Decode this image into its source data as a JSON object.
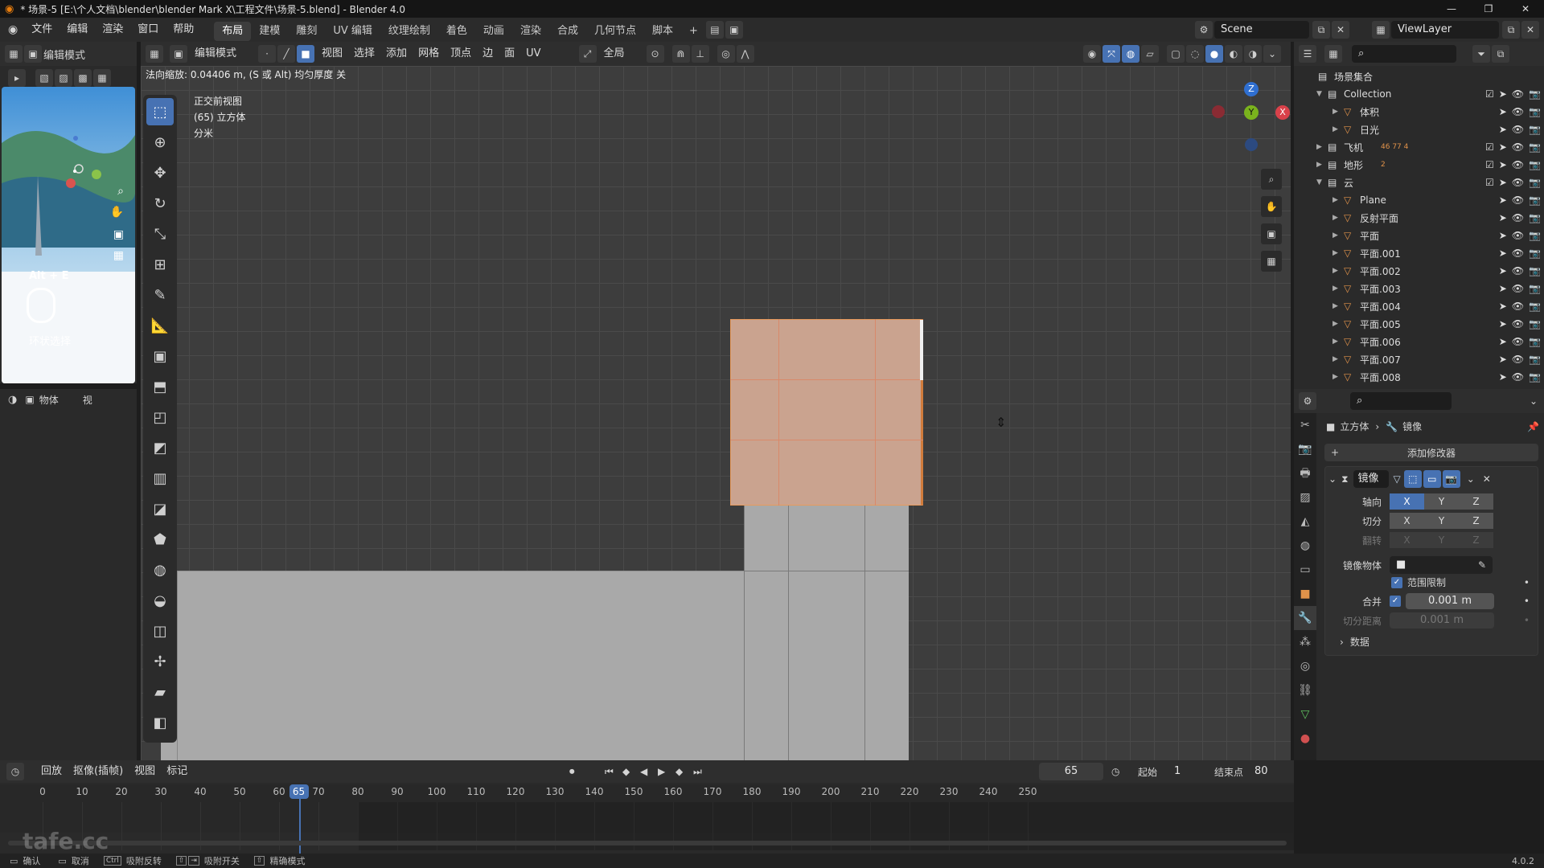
{
  "window": {
    "title": "* 场景-5 [E:\\个人文档\\blender\\blender Mark X\\工程文件\\场景-5.blend] - Blender 4.0",
    "controls": [
      "—",
      "❐",
      "✕"
    ]
  },
  "menu": {
    "items": [
      "文件",
      "编辑",
      "渲染",
      "窗口",
      "帮助"
    ],
    "workspaces": [
      "布局",
      "建模",
      "雕刻",
      "UV 编辑",
      "纹理绘制",
      "着色",
      "动画",
      "渲染",
      "合成",
      "几何节点",
      "脚本"
    ],
    "active_workspace": "布局",
    "add_tab": "+",
    "scene": "Scene",
    "view_layer": "ViewLayer"
  },
  "left_panel": {
    "mode": "编辑模式",
    "overlay_hint": "Alt + E",
    "tool_hint": "环状选择",
    "object_label": "物体",
    "view_label": "视"
  },
  "viewport_header": {
    "mode": "编辑模式",
    "menus": [
      "视图",
      "选择",
      "添加",
      "网格",
      "顶点",
      "边",
      "面",
      "UV"
    ],
    "transform": "全局"
  },
  "viewport": {
    "status": "法向缩放: 0.04406 m, (S 或 Alt) 均匀厚度 关",
    "info_lines": [
      "正交前视图",
      "(65) 立方体",
      "分米"
    ],
    "gizmo": {
      "z": "Z",
      "y": "Y",
      "x": "X"
    }
  },
  "outliner": {
    "root": "场景集合",
    "items": [
      {
        "name": "Collection",
        "depth": 0
      },
      {
        "name": "体积",
        "depth": 1
      },
      {
        "name": "日光",
        "depth": 1
      },
      {
        "name": "飞机",
        "depth": 0
      },
      {
        "name": "地形",
        "depth": 0
      },
      {
        "name": "云",
        "depth": 0
      },
      {
        "name": "Plane",
        "depth": 1
      },
      {
        "name": "反射平面",
        "depth": 1
      },
      {
        "name": "平面",
        "depth": 1
      },
      {
        "name": "平面.001",
        "depth": 1
      },
      {
        "name": "平面.002",
        "depth": 1
      },
      {
        "name": "平面.003",
        "depth": 1
      },
      {
        "name": "平面.004",
        "depth": 1
      },
      {
        "name": "平面.005",
        "depth": 1
      },
      {
        "name": "平面.006",
        "depth": 1
      },
      {
        "name": "平面.007",
        "depth": 1
      },
      {
        "name": "平面.008",
        "depth": 1
      }
    ],
    "badges": {
      "飞机": "46   77  4",
      "地形": "2"
    }
  },
  "properties": {
    "breadcrumb_object": "立方体",
    "breadcrumb_modifier": "镜像",
    "add_modifier": "添加修改器",
    "modifier_name": "镜像",
    "axis_label": "轴向",
    "bisect_label": "切分",
    "flip_label": "翻转",
    "axes": [
      "X",
      "Y",
      "Z"
    ],
    "mirror_object_label": "镜像物体",
    "clipping_label": "范围限制",
    "merge_label": "合并",
    "merge_value": "0.001 m",
    "bisect_distance_label": "切分距离",
    "bisect_distance_value": "0.001 m",
    "data_label": "数据"
  },
  "timeline": {
    "menus": [
      "回放",
      "抠像(插帧)",
      "视图",
      "标记"
    ],
    "current_frame": "65",
    "start_label": "起始",
    "start": "1",
    "end_label": "结束点",
    "end": "80",
    "ticks": [
      "0",
      "10",
      "20",
      "30",
      "40",
      "50",
      "60",
      "70",
      "80",
      "90",
      "100",
      "110",
      "120",
      "130",
      "140",
      "150",
      "160",
      "170",
      "180",
      "190",
      "200",
      "210",
      "220",
      "230",
      "240",
      "250"
    ]
  },
  "statusbar": {
    "items": [
      "确认",
      "取消",
      "吸附反转",
      "吸附开关",
      "精确模式"
    ],
    "version": "4.0.2",
    "watermark": "tafe.cc"
  },
  "colors": {
    "accent": "#4772b3",
    "selected_face": "#caa38f",
    "selection_edge": "#e89a5c"
  }
}
